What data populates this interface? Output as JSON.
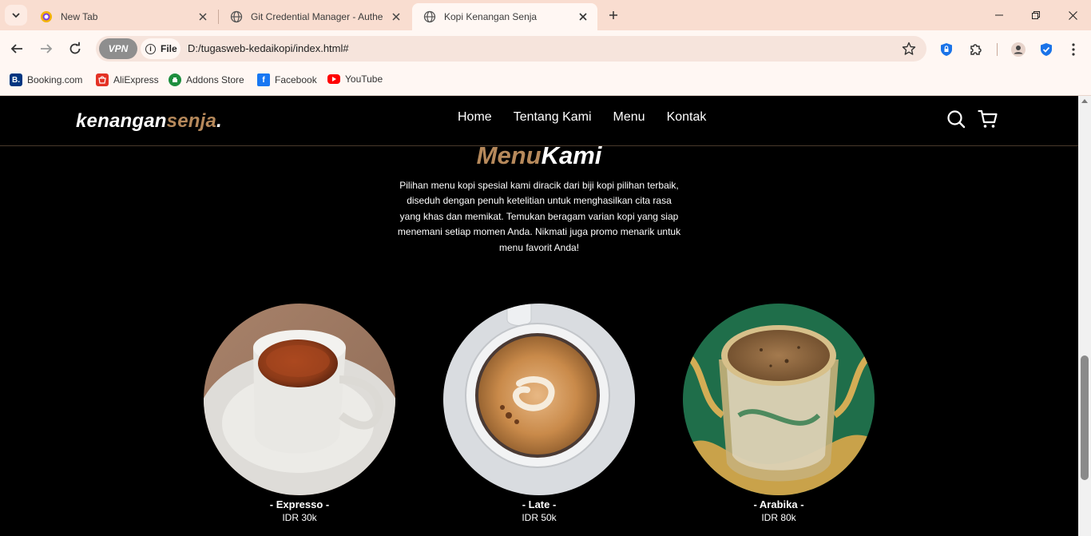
{
  "browser": {
    "tabs": [
      {
        "title": "New Tab",
        "active": false
      },
      {
        "title": "Git Credential Manager - Authe",
        "active": false
      },
      {
        "title": "Kopi Kenangan Senja",
        "active": true
      }
    ],
    "address": {
      "vpn_label": "VPN",
      "scheme_label": "File",
      "url": "D:/tugasweb-kedaikopi/index.html#"
    },
    "bookmarks": [
      {
        "label": "Booking.com",
        "icon": "booking-icon",
        "color": "#003580"
      },
      {
        "label": "AliExpress",
        "icon": "aliexpress-icon",
        "color": "#e43225"
      },
      {
        "label": "Addons Store",
        "icon": "addons-store-icon",
        "color": "#1e8e3e"
      },
      {
        "label": "Facebook",
        "icon": "facebook-icon",
        "color": "#1877f2"
      },
      {
        "label": "YouTube",
        "icon": "youtube-icon",
        "color": "#ff0000"
      }
    ]
  },
  "site": {
    "logo": {
      "part1": "kenangan",
      "part2": "senja",
      "part3": "."
    },
    "nav": [
      "Home",
      "Tentang Kami",
      "Menu",
      "Kontak"
    ],
    "menu_section": {
      "title_accent": "Menu",
      "title_rest": "Kami",
      "description": "Pilihan menu kopi spesial kami diracik dari biji kopi pilihan terbaik, diseduh dengan penuh ketelitian untuk menghasilkan cita rasa yang khas dan memikat. Temukan beragam varian kopi yang siap menemani setiap momen Anda. Nikmati juga promo menarik untuk menu favorit Anda!",
      "items": [
        {
          "name": "- Expresso -",
          "price": "IDR 30k"
        },
        {
          "name": "- Late -",
          "price": "IDR 50k"
        },
        {
          "name": "- Arabika -",
          "price": "IDR 80k"
        }
      ]
    },
    "colors": {
      "accent": "#b6895b",
      "background": "#000000",
      "text": "#ffffff"
    }
  }
}
